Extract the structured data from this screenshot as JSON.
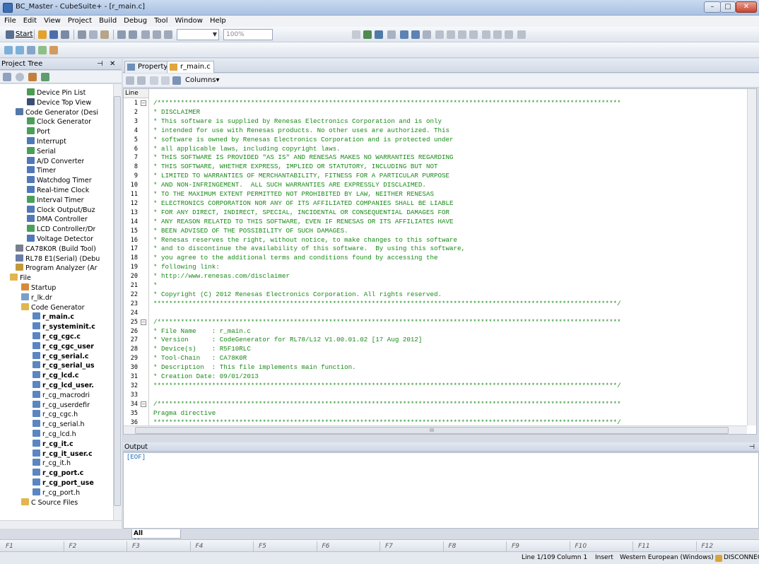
{
  "window": {
    "title": "BC_Master - CubeSuite+ - [r_main.c]"
  },
  "menu": [
    "File",
    "Edit",
    "View",
    "Project",
    "Build",
    "Debug",
    "Tool",
    "Window",
    "Help"
  ],
  "toolbar": {
    "start_label": "Start",
    "zoom_value": "100%"
  },
  "project_tree": {
    "title": "Project Tree",
    "items": [
      {
        "label": "Device Pin List",
        "indent": 4,
        "icon": "doc-green-icon",
        "bold": false
      },
      {
        "label": "Device Top View",
        "indent": 4,
        "icon": "chip-icon",
        "bold": false
      },
      {
        "label": "Code Generator (Desi",
        "indent": 2,
        "icon": "code-generator-icon",
        "bold": false
      },
      {
        "label": "Clock Generator",
        "indent": 4,
        "icon": "gear-green-icon",
        "bold": false
      },
      {
        "label": "Port",
        "indent": 4,
        "icon": "gear-green-icon",
        "bold": false
      },
      {
        "label": "Interrupt",
        "indent": 4,
        "icon": "gear-blue-icon",
        "bold": false
      },
      {
        "label": "Serial",
        "indent": 4,
        "icon": "gear-green-icon",
        "bold": false
      },
      {
        "label": "A/D Converter",
        "indent": 4,
        "icon": "gear-blue-icon",
        "bold": false
      },
      {
        "label": "Timer",
        "indent": 4,
        "icon": "gear-blue-icon",
        "bold": false
      },
      {
        "label": "Watchdog Timer",
        "indent": 4,
        "icon": "gear-blue-icon",
        "bold": false
      },
      {
        "label": "Real-time Clock",
        "indent": 4,
        "icon": "gear-blue-icon",
        "bold": false
      },
      {
        "label": "Interval Timer",
        "indent": 4,
        "icon": "gear-green-icon",
        "bold": false
      },
      {
        "label": "Clock Output/Buz",
        "indent": 4,
        "icon": "gear-blue-icon",
        "bold": false
      },
      {
        "label": "DMA Controller",
        "indent": 4,
        "icon": "gear-blue-icon",
        "bold": false
      },
      {
        "label": "LCD Controller/Dr",
        "indent": 4,
        "icon": "gear-green-icon",
        "bold": false
      },
      {
        "label": "Voltage Detector",
        "indent": 4,
        "icon": "gear-blue-icon",
        "bold": false
      },
      {
        "label": "CA78K0R (Build Tool)",
        "indent": 2,
        "icon": "build-tool-icon",
        "bold": false
      },
      {
        "label": "RL78 E1(Serial) (Debu",
        "indent": 2,
        "icon": "debugger-icon",
        "bold": false
      },
      {
        "label": "Program Analyzer (Ar",
        "indent": 2,
        "icon": "analyzer-icon",
        "bold": false
      },
      {
        "label": "File",
        "indent": 1,
        "icon": "folder-icon",
        "bold": false
      },
      {
        "label": "Startup",
        "indent": 3,
        "icon": "startup-folder-icon",
        "bold": false
      },
      {
        "label": "r_lk.dr",
        "indent": 3,
        "icon": "file-dr-icon",
        "bold": false
      },
      {
        "label": "Code Generator",
        "indent": 3,
        "icon": "folder-icon",
        "bold": false
      },
      {
        "label": "r_main.c",
        "indent": 5,
        "icon": "c-file-icon",
        "bold": true
      },
      {
        "label": "r_systeminit.c",
        "indent": 5,
        "icon": "c-file-icon",
        "bold": true
      },
      {
        "label": "r_cg_cgc.c",
        "indent": 5,
        "icon": "c-file-icon",
        "bold": true
      },
      {
        "label": "r_cg_cgc_user",
        "indent": 5,
        "icon": "c-file-icon",
        "bold": true
      },
      {
        "label": "r_cg_serial.c",
        "indent": 5,
        "icon": "c-file-icon",
        "bold": true
      },
      {
        "label": "r_cg_serial_us",
        "indent": 5,
        "icon": "c-file-icon",
        "bold": true
      },
      {
        "label": "r_cg_lcd.c",
        "indent": 5,
        "icon": "c-file-icon",
        "bold": true
      },
      {
        "label": "r_cg_lcd_user.",
        "indent": 5,
        "icon": "c-file-icon",
        "bold": true
      },
      {
        "label": "r_cg_macrodri",
        "indent": 5,
        "icon": "h-file-icon",
        "bold": false
      },
      {
        "label": "r_cg_userdefir",
        "indent": 5,
        "icon": "h-file-icon",
        "bold": false
      },
      {
        "label": "r_cg_cgc.h",
        "indent": 5,
        "icon": "h-file-icon",
        "bold": false
      },
      {
        "label": "r_cg_serial.h",
        "indent": 5,
        "icon": "h-file-icon",
        "bold": false
      },
      {
        "label": "r_cg_lcd.h",
        "indent": 5,
        "icon": "h-file-icon",
        "bold": false
      },
      {
        "label": "r_cg_it.c",
        "indent": 5,
        "icon": "c-file-icon",
        "bold": true
      },
      {
        "label": "r_cg_it_user.c",
        "indent": 5,
        "icon": "c-file-icon",
        "bold": true
      },
      {
        "label": "r_cg_it.h",
        "indent": 5,
        "icon": "h-file-icon",
        "bold": false
      },
      {
        "label": "r_cg_port.c",
        "indent": 5,
        "icon": "c-file-icon",
        "bold": true
      },
      {
        "label": "r_cg_port_use",
        "indent": 5,
        "icon": "c-file-icon",
        "bold": true
      },
      {
        "label": "r_cg_port.h",
        "indent": 5,
        "icon": "h-file-icon",
        "bold": false
      },
      {
        "label": "C Source Files",
        "indent": 3,
        "icon": "folder-icon",
        "bold": false
      }
    ]
  },
  "editor": {
    "tabs": [
      {
        "label": "Property"
      },
      {
        "label": "r_main.c"
      }
    ],
    "columns_label": "Columns",
    "line_header": "Line",
    "lines": [
      {
        "n": "1",
        "text": "/***********************************************************************************************************************",
        "fold": true
      },
      {
        "n": "2",
        "text": "* DISCLAIMER",
        "fold": false
      },
      {
        "n": "3",
        "text": "* This software is supplied by Renesas Electronics Corporation and is only",
        "fold": false
      },
      {
        "n": "4",
        "text": "* intended for use with Renesas products. No other uses are authorized. This",
        "fold": false
      },
      {
        "n": "5",
        "text": "* software is owned by Renesas Electronics Corporation and is protected under",
        "fold": false
      },
      {
        "n": "6",
        "text": "* all applicable laws, including copyright laws.",
        "fold": false
      },
      {
        "n": "7",
        "text": "* THIS SOFTWARE IS PROVIDED \"AS IS\" AND RENESAS MAKES NO WARRANTIES REGARDING",
        "fold": false
      },
      {
        "n": "8",
        "text": "* THIS SOFTWARE, WHETHER EXPRESS, IMPLIED OR STATUTORY, INCLUDING BUT NOT",
        "fold": false
      },
      {
        "n": "9",
        "text": "* LIMITED TO WARRANTIES OF MERCHANTABILITY, FITNESS FOR A PARTICULAR PURPOSE",
        "fold": false
      },
      {
        "n": "10",
        "text": "* AND NON-INFRINGEMENT.  ALL SUCH WARRANTIES ARE EXPRESSLY DISCLAIMED.",
        "fold": false
      },
      {
        "n": "11",
        "text": "* TO THE MAXIMUM EXTENT PERMITTED NOT PROHIBITED BY LAW, NEITHER RENESAS",
        "fold": false
      },
      {
        "n": "12",
        "text": "* ELECTRONICS CORPORATION NOR ANY OF ITS AFFILIATED COMPANIES SHALL BE LIABLE",
        "fold": false
      },
      {
        "n": "13",
        "text": "* FOR ANY DIRECT, INDIRECT, SPECIAL, INCIDENTAL OR CONSEQUENTIAL DAMAGES FOR",
        "fold": false
      },
      {
        "n": "14",
        "text": "* ANY REASON RELATED TO THIS SOFTWARE, EVEN IF RENESAS OR ITS AFFILIATES HAVE",
        "fold": false
      },
      {
        "n": "15",
        "text": "* BEEN ADVISED OF THE POSSIBILITY OF SUCH DAMAGES.",
        "fold": false
      },
      {
        "n": "16",
        "text": "* Renesas reserves the right, without notice, to make changes to this software",
        "fold": false
      },
      {
        "n": "17",
        "text": "* and to discontinue the availability of this software.  By using this software,",
        "fold": false
      },
      {
        "n": "18",
        "text": "* you agree to the additional terms and conditions found by accessing the",
        "fold": false
      },
      {
        "n": "19",
        "text": "* following link:",
        "fold": false
      },
      {
        "n": "20",
        "text": "* http://www.renesas.com/disclaimer",
        "fold": false
      },
      {
        "n": "21",
        "text": "*",
        "fold": false
      },
      {
        "n": "22",
        "text": "* Copyright (C) 2012 Renesas Electronics Corporation. All rights reserved.",
        "fold": false
      },
      {
        "n": "23",
        "text": "***********************************************************************************************************************/",
        "fold": false
      },
      {
        "n": "24",
        "text": "",
        "fold": false
      },
      {
        "n": "25",
        "text": "/***********************************************************************************************************************",
        "fold": true
      },
      {
        "n": "26",
        "text": "* File Name    : r_main.c",
        "fold": false
      },
      {
        "n": "27",
        "text": "* Version      : CodeGenerator for RL78/L12 V1.00.01.02 [17 Aug 2012]",
        "fold": false
      },
      {
        "n": "28",
        "text": "* Device(s)    : R5F10RLC",
        "fold": false
      },
      {
        "n": "29",
        "text": "* Tool-Chain   : CA78K0R",
        "fold": false
      },
      {
        "n": "30",
        "text": "* Description  : This file implements main function.",
        "fold": false
      },
      {
        "n": "31",
        "text": "* Creation Date: 09/01/2013",
        "fold": false
      },
      {
        "n": "32",
        "text": "***********************************************************************************************************************/",
        "fold": false
      },
      {
        "n": "33",
        "text": "",
        "fold": false
      },
      {
        "n": "34",
        "text": "/***********************************************************************************************************************",
        "fold": true
      },
      {
        "n": "35",
        "text": "Pragma directive",
        "fold": false
      },
      {
        "n": "36",
        "text": "***********************************************************************************************************************/",
        "fold": false
      }
    ]
  },
  "output": {
    "title": "Output",
    "text": "[EOF]",
    "tab_label": "All Messages"
  },
  "function_keys": [
    "F1",
    "F2",
    "F3",
    "F4",
    "F5",
    "F6",
    "F7",
    "F8",
    "F9",
    "F10",
    "F11",
    "F12"
  ],
  "status": {
    "line": "Line 1/109",
    "column": "Column 1",
    "mode": "Insert",
    "encoding": "Western European (Windows)",
    "connection": "DISCONNECT"
  }
}
